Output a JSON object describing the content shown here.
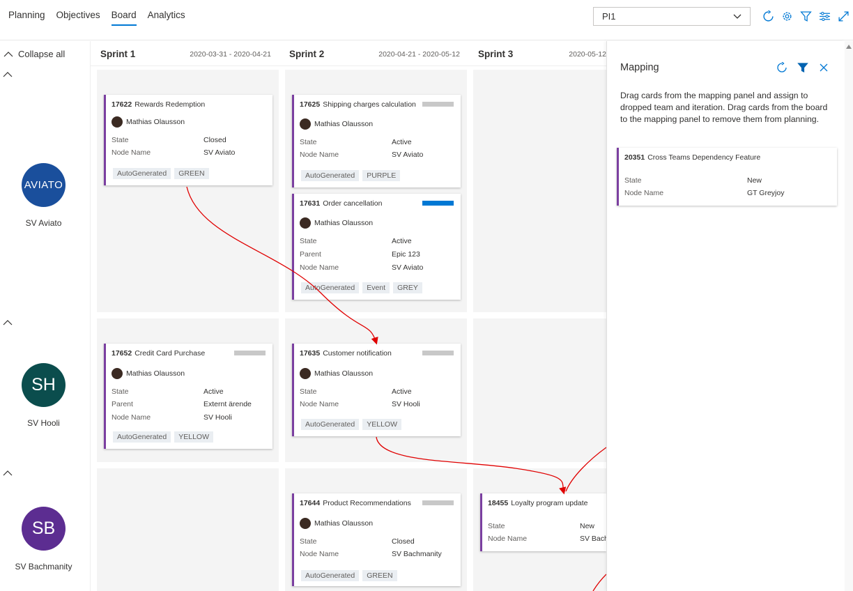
{
  "nav": {
    "tabs": [
      {
        "label": "Planning"
      },
      {
        "label": "Objectives"
      },
      {
        "label": "Board"
      },
      {
        "label": "Analytics"
      }
    ]
  },
  "pi_select": {
    "value": "PI1"
  },
  "toolbar": {
    "icons": [
      "refresh-icon",
      "gear-icon",
      "filter-icon",
      "settings-sliders-icon",
      "expand-icon"
    ]
  },
  "rail": {
    "collapse_all": "Collapse all"
  },
  "teams": [
    {
      "name": "SV Aviato",
      "avatar_text": "AVIATO",
      "color": "#1a4f9c"
    },
    {
      "name": "SV Hooli",
      "avatar_text": "SH",
      "color": "#0b4d4d"
    },
    {
      "name": "SV Bachmanity",
      "avatar_text": "SB",
      "color": "#5c2d91"
    }
  ],
  "sprints": [
    {
      "name": "Sprint 1",
      "dates": "2020-03-31 - 2020-04-21"
    },
    {
      "name": "Sprint 2",
      "dates": "2020-04-21 - 2020-05-12"
    },
    {
      "name": "Sprint 3",
      "dates": "2020-05-12"
    }
  ],
  "cards": {
    "c17622": {
      "id": "17622",
      "title": "Rewards Redemption",
      "owner": "Mathias Olausson",
      "fields": [
        {
          "k": "State",
          "v": "Closed"
        },
        {
          "k": "Node Name",
          "v": "SV Aviato"
        }
      ],
      "tags": [
        "AutoGenerated",
        "GREEN"
      ]
    },
    "c17625": {
      "id": "17625",
      "title": "Shipping charges calculation",
      "owner": "Mathias Olausson",
      "fields": [
        {
          "k": "State",
          "v": "Active"
        },
        {
          "k": "Node Name",
          "v": "SV Aviato"
        }
      ],
      "tags": [
        "AutoGenerated",
        "PURPLE"
      ]
    },
    "c17631": {
      "id": "17631",
      "title": "Order cancellation",
      "owner": "Mathias Olausson",
      "fields": [
        {
          "k": "State",
          "v": "Active"
        },
        {
          "k": "Parent",
          "v": "Epic 123"
        },
        {
          "k": "Node Name",
          "v": "SV Aviato"
        }
      ],
      "tags": [
        "AutoGenerated",
        "Event",
        "GREY"
      ],
      "bar_color": "#0078d4"
    },
    "c17652": {
      "id": "17652",
      "title": "Credit Card Purchase",
      "owner": "Mathias Olausson",
      "fields": [
        {
          "k": "State",
          "v": "Active"
        },
        {
          "k": "Parent",
          "v": "Externt ärende"
        },
        {
          "k": "Node Name",
          "v": "SV Hooli"
        }
      ],
      "tags": [
        "AutoGenerated",
        "YELLOW"
      ]
    },
    "c17635": {
      "id": "17635",
      "title": "Customer notification",
      "owner": "Mathias Olausson",
      "fields": [
        {
          "k": "State",
          "v": "Active"
        },
        {
          "k": "Node Name",
          "v": "SV Hooli"
        }
      ],
      "tags": [
        "AutoGenerated",
        "YELLOW"
      ]
    },
    "c17644": {
      "id": "17644",
      "title": "Product Recommendations",
      "owner": "Mathias Olausson",
      "fields": [
        {
          "k": "State",
          "v": "Closed"
        },
        {
          "k": "Node Name",
          "v": "SV Bachmanity"
        }
      ],
      "tags": [
        "AutoGenerated",
        "GREEN"
      ]
    },
    "c18455": {
      "id": "18455",
      "title": "Loyalty program update",
      "fields": [
        {
          "k": "State",
          "v": "New"
        },
        {
          "k": "Node Name",
          "v": "SV Bach"
        }
      ]
    }
  },
  "mapping": {
    "title": "Mapping",
    "description": "Drag cards from the mapping panel and assign to dropped team and iteration. Drag cards from the board to the mapping panel to remove them from planning.",
    "card": {
      "id": "20351",
      "title": "Cross Teams Dependency Feature",
      "fields": [
        {
          "k": "State",
          "v": "New"
        },
        {
          "k": "Node Name",
          "v": "GT Greyjoy"
        }
      ]
    }
  },
  "colors": {
    "accent": "#0078d4",
    "card_border": "#7b3fa0",
    "dependency_arrow": "#e00000"
  }
}
